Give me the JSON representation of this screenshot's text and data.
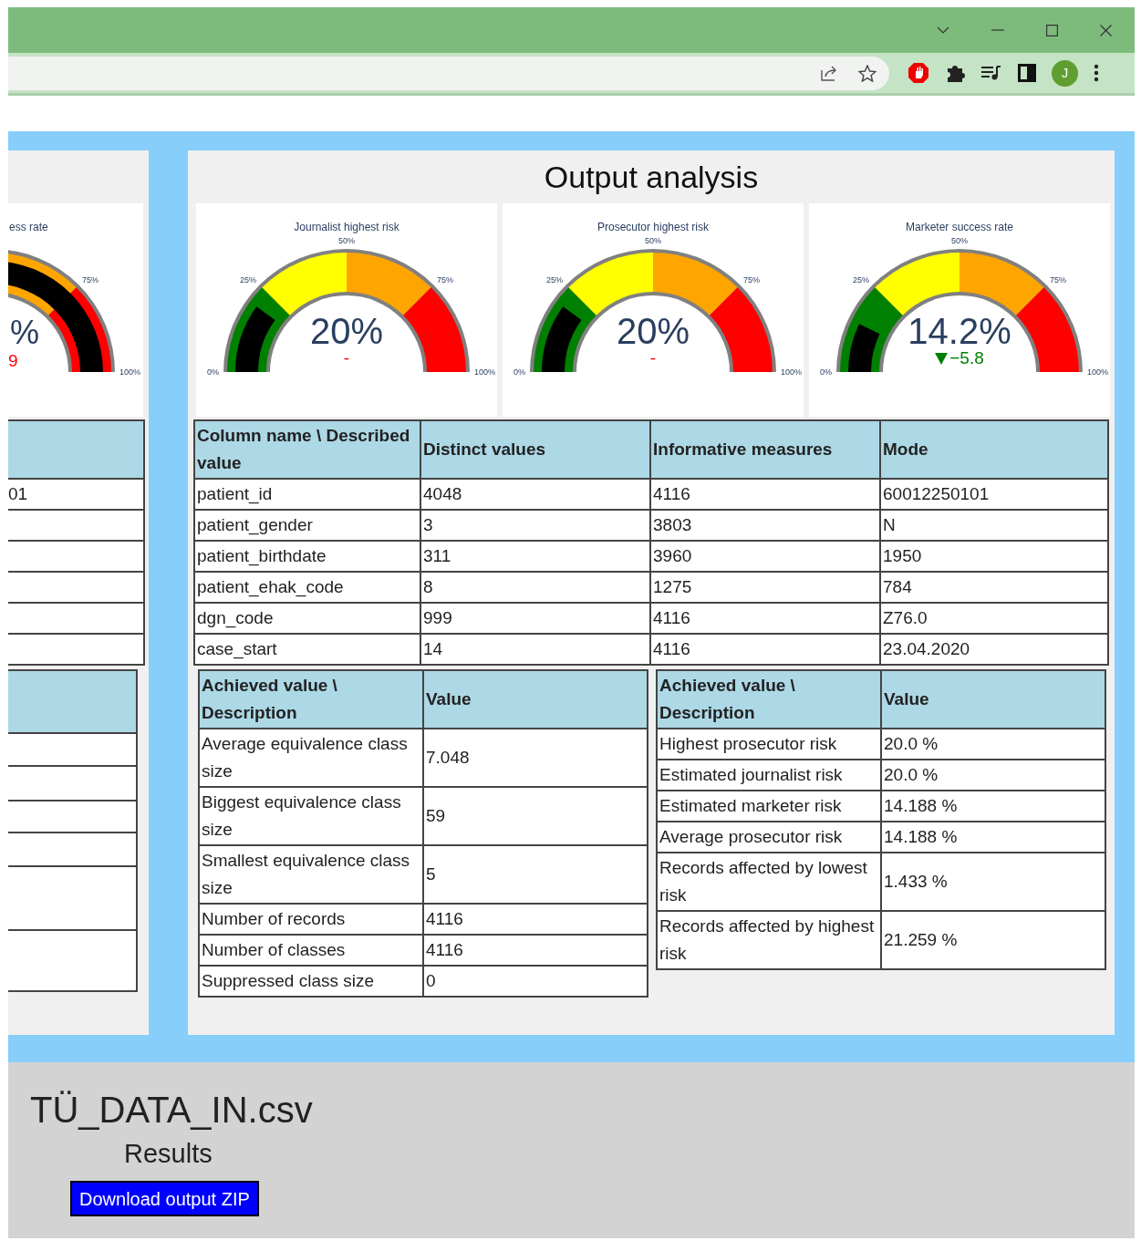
{
  "browser": {
    "avatar_letter": "J"
  },
  "left_panel": {
    "gauge": {
      "title": "ess rate",
      "value": "%",
      "delta": "9",
      "kind": "plain",
      "ticks": [
        "75%",
        "100%"
      ]
    },
    "attribute_table_cells": [
      "01"
    ]
  },
  "output_analysis": {
    "title": "Output analysis",
    "gauges": [
      {
        "title": "Journalist highest risk",
        "value": "20%",
        "delta": "-",
        "kind": "plain",
        "ticks": [
          "0%",
          "25%",
          "50%",
          "75%",
          "100%"
        ]
      },
      {
        "title": "Prosecutor highest risk",
        "value": "20%",
        "delta": "-",
        "kind": "plain",
        "ticks": [
          "0%",
          "25%",
          "50%",
          "75%",
          "100%"
        ]
      },
      {
        "title": "Marketer success rate",
        "value": "14.2%",
        "delta": "−5.8",
        "kind": "down",
        "ticks": [
          "0%",
          "25%",
          "50%",
          "75%",
          "100%"
        ]
      }
    ],
    "attribute_table": {
      "columns": [
        "Column name \\ Described value",
        "Distinct values",
        "Informative measures",
        "Mode"
      ],
      "rows": [
        [
          "patient_id",
          "4048",
          "4116",
          "60012250101"
        ],
        [
          "patient_gender",
          "3",
          "3803",
          "N"
        ],
        [
          "patient_birthdate",
          "311",
          "3960",
          "1950"
        ],
        [
          "patient_ehak_code",
          "8",
          "1275",
          "784"
        ],
        [
          "dgn_code",
          "999",
          "4116",
          "Z76.0"
        ],
        [
          "case_start",
          "14",
          "4116",
          "23.04.2020"
        ]
      ]
    },
    "equivalence_table": {
      "columns": [
        "Achieved value \\ Description",
        "Value"
      ],
      "rows": [
        [
          "Average equivalence class size",
          "7.048"
        ],
        [
          "Biggest equivalence class size",
          "59"
        ],
        [
          "Smallest equivalence class size",
          "5"
        ],
        [
          "Number of records",
          "4116"
        ],
        [
          "Number of classes",
          "4116"
        ],
        [
          "Suppressed class size",
          "0"
        ]
      ]
    },
    "risk_table": {
      "columns": [
        "Achieved value \\ Description",
        "Value"
      ],
      "rows": [
        [
          "Highest prosecutor risk",
          "20.0 %"
        ],
        [
          "Estimated journalist risk",
          "20.0 %"
        ],
        [
          "Estimated marketer risk",
          "14.188 %"
        ],
        [
          "Average prosecutor risk",
          "14.188 %"
        ],
        [
          "Records affected by lowest risk",
          "1.433 %"
        ],
        [
          "Records affected by highest risk",
          "21.259 %"
        ]
      ]
    }
  },
  "file": {
    "name": "TÜ_DATA_IN.csv",
    "subtitle": "Results",
    "download_button": "Download output ZIP"
  }
}
